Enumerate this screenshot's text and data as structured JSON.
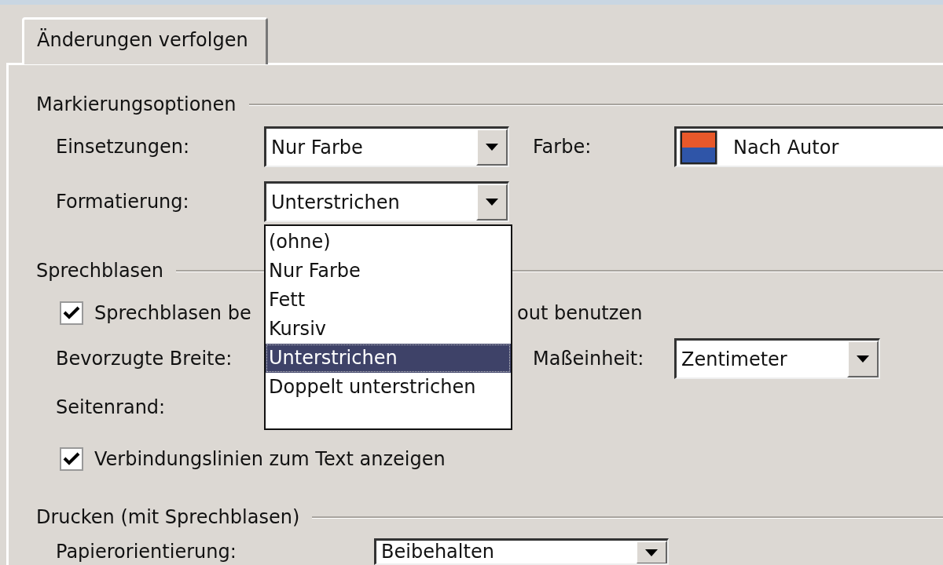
{
  "tabs": [
    {
      "label": "Änderungen verfolgen",
      "selected": true
    }
  ],
  "markup_options": {
    "title": "Markierungsoptionen",
    "insertions": {
      "label": "Einsetzungen:",
      "value": "Nur Farbe"
    },
    "color": {
      "label": "Farbe:",
      "value": "Nach Autor"
    },
    "formatting": {
      "label": "Formatierung:",
      "value": "Unterstrichen",
      "expanded": true,
      "options": [
        {
          "label": "(ohne)",
          "selected": false
        },
        {
          "label": "Nur Farbe",
          "selected": false
        },
        {
          "label": "Fett",
          "selected": false
        },
        {
          "label": "Kursiv",
          "selected": false
        },
        {
          "label": "Unterstrichen",
          "selected": true
        },
        {
          "label": "Doppelt unterstrichen",
          "selected": false
        }
      ]
    }
  },
  "balloons": {
    "title": "Sprechblasen",
    "use_balloons": {
      "label_start": "Sprechblasen be",
      "label_end": "out benutzen",
      "checked": true
    },
    "preferred_width": {
      "label": "Bevorzugte Breite:"
    },
    "unit": {
      "label": "Maßeinheit:",
      "value": "Zentimeter"
    },
    "margin": {
      "label": "Seitenrand:"
    },
    "connecting_lines": {
      "label": "Verbindungslinien zum Text anzeigen",
      "checked": true
    }
  },
  "printing": {
    "title": "Drucken (mit Sprechblasen)",
    "orientation": {
      "label": "Papierorientierung:",
      "value": "Beibehalten"
    }
  }
}
